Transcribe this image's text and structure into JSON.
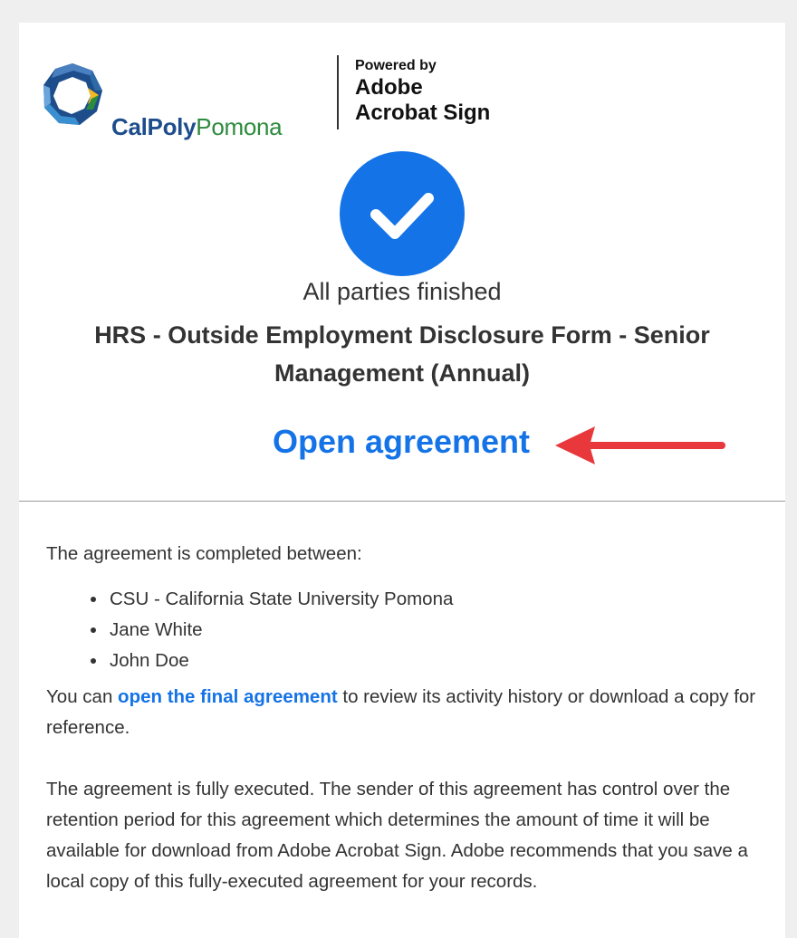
{
  "brand": {
    "university_part1": "CalPoly",
    "university_part2": "Pomona",
    "powered_by": "Powered by",
    "adobe": "Adobe",
    "acrobat_sign": "Acrobat Sign",
    "cpp_blue": "#1e4d8c",
    "cpp_green": "#2c8b3c",
    "cpp_gold": "#f3b922"
  },
  "status": {
    "icon": "checkmark-icon",
    "circle_color": "#1473e6",
    "text": "All parties finished"
  },
  "agreement": {
    "title": "HRS - Outside Employment Disclosure Form - Senior Management (Annual)",
    "open_link_label": "Open agreement",
    "link_color": "#1473e6",
    "annotation_arrow_color": "#e8383b"
  },
  "body": {
    "intro": "The agreement is completed between:",
    "parties": [
      "CSU - California State University Pomona",
      "Jane White",
      "John Doe"
    ],
    "review_prefix": "You can ",
    "review_link": "open the final agreement",
    "review_suffix": " to review its activity history or download a copy for reference.",
    "retention": "The agreement is fully executed. The sender of this agreement has control over the retention period for this agreement which determines the amount of time it will be available for download from Adobe Acrobat Sign. Adobe recommends that you save a local copy of this fully-executed agreement for your records."
  }
}
